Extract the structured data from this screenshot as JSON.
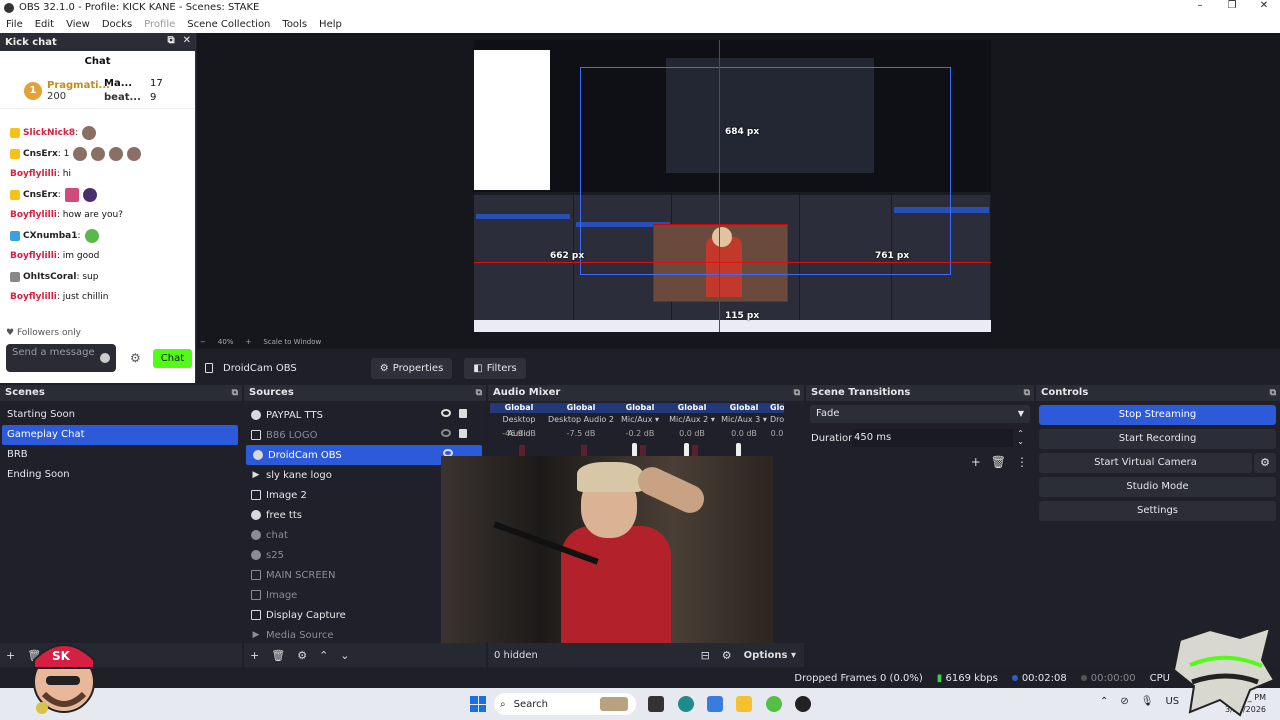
{
  "window": {
    "title": "OBS 32.1.0 - Profile: KICK KANE - Scenes: STAKE",
    "controls": [
      "–",
      "❐",
      "✕"
    ]
  },
  "menu": [
    "File",
    "Edit",
    "View",
    "Docks",
    "Profile",
    "Scene Collection",
    "Tools",
    "Help"
  ],
  "chat_dock": {
    "dock_title": "Kick chat",
    "chat_heading": "Chat",
    "leaderboard": [
      {
        "rank": "1",
        "name": "Pragmati...",
        "points": "200"
      },
      {
        "name": "Ma...",
        "points": "17"
      },
      {
        "name": "beat...",
        "points": "9"
      }
    ],
    "messages": [
      {
        "user": "SlickNick8",
        "text": ":"
      },
      {
        "user": "CnsErx",
        "text": ": 1"
      },
      {
        "user": "Boyflylilli",
        "text": ": hi"
      },
      {
        "user": "CnsErx",
        "text": ":"
      },
      {
        "user": "Boyflylilli",
        "text": ": how are you?"
      },
      {
        "user": "CXnumba1",
        "text": ":"
      },
      {
        "user": "Boyflylilli",
        "text": ": im good"
      },
      {
        "user": "OhItsCoral",
        "text": ": sup"
      },
      {
        "user": "Boyflylilli",
        "text": ": just chillin"
      }
    ],
    "followers_only": "Followers only",
    "input_placeholder": "Send a message",
    "send_button": "Chat"
  },
  "preview": {
    "labels": {
      "top": "684 px",
      "left": "662 px",
      "right": "761 px",
      "bottom": "115 px"
    },
    "zoom": "40%",
    "scale_mode": "Scale to Window"
  },
  "source_toolbar": {
    "selected_source": "DroidCam OBS",
    "properties": "Properties",
    "filters": "Filters"
  },
  "scenes": {
    "title": "Scenes",
    "items": [
      "Starting Soon",
      "Gameplay Chat",
      "BRB",
      "Ending Soon"
    ],
    "active": "Gameplay Chat"
  },
  "sources": {
    "title": "Sources",
    "items": [
      {
        "name": "PAYPAL TTS",
        "icon": "globe-icon"
      },
      {
        "name": "B86 LOGO",
        "icon": "image-icon"
      },
      {
        "name": "DroidCam OBS",
        "icon": "globe-icon"
      },
      {
        "name": "sly kane logo",
        "icon": "play-icon"
      },
      {
        "name": "Image 2",
        "icon": "image-icon"
      },
      {
        "name": "free tts",
        "icon": "globe-icon"
      },
      {
        "name": "chat",
        "icon": "globe-icon"
      },
      {
        "name": "s25",
        "icon": "globe-icon"
      },
      {
        "name": "MAIN SCREEN",
        "icon": "window-icon"
      },
      {
        "name": "Image",
        "icon": "image-icon"
      },
      {
        "name": "Display Capture",
        "icon": "monitor-icon"
      },
      {
        "name": "Media Source",
        "icon": "play-icon"
      }
    ]
  },
  "mixer": {
    "title": "Audio Mixer",
    "channels": [
      {
        "group": "Global",
        "name": "Desktop Audio",
        "db": "-46.9 dB"
      },
      {
        "group": "Global",
        "name": "Desktop Audio 2",
        "db": "-7.5 dB"
      },
      {
        "group": "Global",
        "name": "Mic/Aux",
        "db": "-0.2 dB"
      },
      {
        "group": "Global",
        "name": "Mic/Aux 2",
        "db": "0.0 dB"
      },
      {
        "group": "Global",
        "name": "Mic/Aux 3",
        "db": "0.0 dB"
      },
      {
        "group": "Global",
        "name": "Dro",
        "db": "0.0"
      }
    ],
    "hidden": "0 hidden",
    "options": "Options"
  },
  "transitions": {
    "title": "Scene Transitions",
    "selected": "Fade",
    "duration_label": "Duration",
    "duration": "450 ms"
  },
  "controls": {
    "title": "Controls",
    "stop_streaming": "Stop Streaming",
    "start_recording": "Start Recording",
    "start_virtual_camera": "Start Virtual Camera",
    "studio_mode": "Studio Mode",
    "settings": "Settings"
  },
  "status": {
    "dropped": "Dropped Frames 0 (0.0%)",
    "bitrate": "6169 kbps",
    "stream_time": "00:02:08",
    "rec_time": "00:00:00",
    "cpu": "CPU"
  },
  "taskbar": {
    "search": "Search",
    "time": "8:4_ PM",
    "date": "3/23/2026",
    "lang": "US"
  },
  "colors": {
    "accent": "#2c5ad8",
    "kick_green": "#53fc18",
    "chat_user": "#d61f42"
  }
}
